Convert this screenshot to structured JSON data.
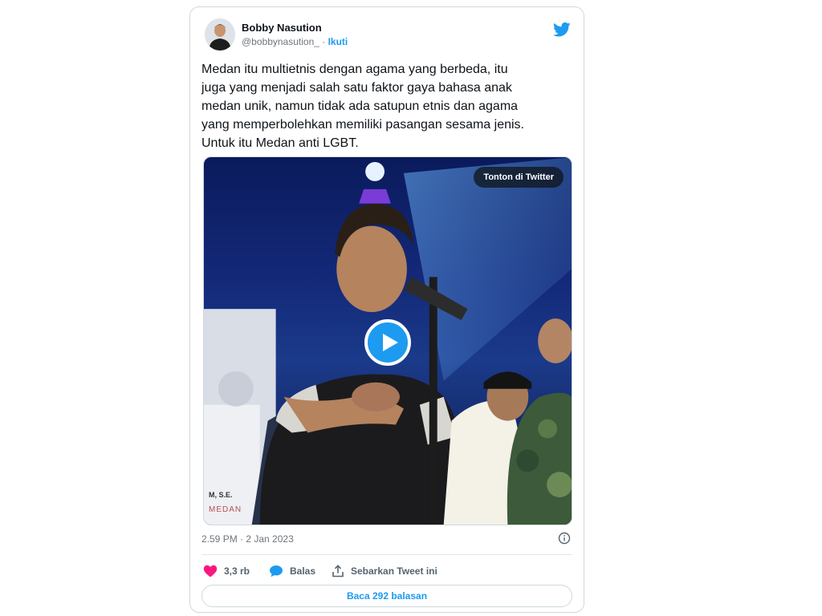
{
  "tweet": {
    "author_name": "Bobby Nasution",
    "handle": "@bobbynasution_",
    "separator": " · ",
    "follow_label": "Ikuti",
    "text": "Medan itu multietnis dengan agama yang berbeda, itu\njuga yang menjadi salah satu faktor gaya bahasa anak\nmedan unik,  namun tidak ada satupun etnis dan agama\nyang memperbolehkan memiliki pasangan sesama jenis.\nUntuk itu Medan anti LGBT.",
    "timestamp": "2.59 PM · 2 Jan 2023"
  },
  "media": {
    "watch_label": "Tonton di Twitter",
    "overlay_name": "M, S.E.",
    "overlay_city": "MEDAN"
  },
  "actions": {
    "like_count": "3,3 rb",
    "reply_label": "Balas",
    "share_label": "Sebarkan Tweet ini"
  },
  "read_replies_label": "Baca 292 balasan",
  "colors": {
    "accent": "#1d9bf0",
    "like": "#f91880",
    "text": "#0f1419",
    "muted": "#6e767d"
  },
  "icons": [
    "twitter-bird-icon",
    "play-icon",
    "heart-icon",
    "reply-bubble-icon",
    "share-icon",
    "info-icon"
  ]
}
